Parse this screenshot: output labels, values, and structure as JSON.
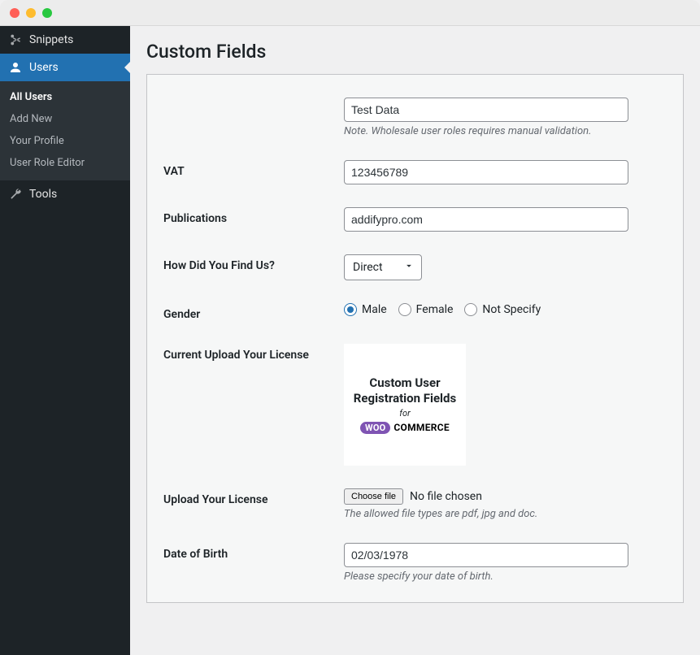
{
  "sidebar": {
    "items": [
      {
        "label": "Snippets"
      },
      {
        "label": "Users"
      },
      {
        "label": "Tools"
      }
    ],
    "submenu": [
      "All Users",
      "Add New",
      "Your Profile",
      "User Role Editor"
    ]
  },
  "page": {
    "title": "Custom Fields"
  },
  "form": {
    "test_data": {
      "value": "Test Data",
      "note": "Note. Wholesale user roles requires manual validation."
    },
    "vat": {
      "label": "VAT",
      "value": "123456789"
    },
    "publications": {
      "label": "Publications",
      "value": "addifypro.com"
    },
    "find_us": {
      "label": "How Did You Find Us?",
      "value": "Direct"
    },
    "gender": {
      "label": "Gender",
      "options": [
        "Male",
        "Female",
        "Not Specify"
      ],
      "selected": "Male"
    },
    "current_upload": {
      "label": "Current Upload Your License",
      "preview": {
        "line1": "Custom User Registration Fields",
        "line2": "for",
        "badge_left": "WOO",
        "badge_right": "COMMERCE"
      }
    },
    "upload": {
      "label": "Upload Your License",
      "button": "Choose file",
      "status": "No file chosen",
      "note": "The allowed file types are pdf, jpg and doc."
    },
    "dob": {
      "label": "Date of Birth",
      "value": "02/03/1978",
      "note": "Please specify your date of birth."
    }
  }
}
